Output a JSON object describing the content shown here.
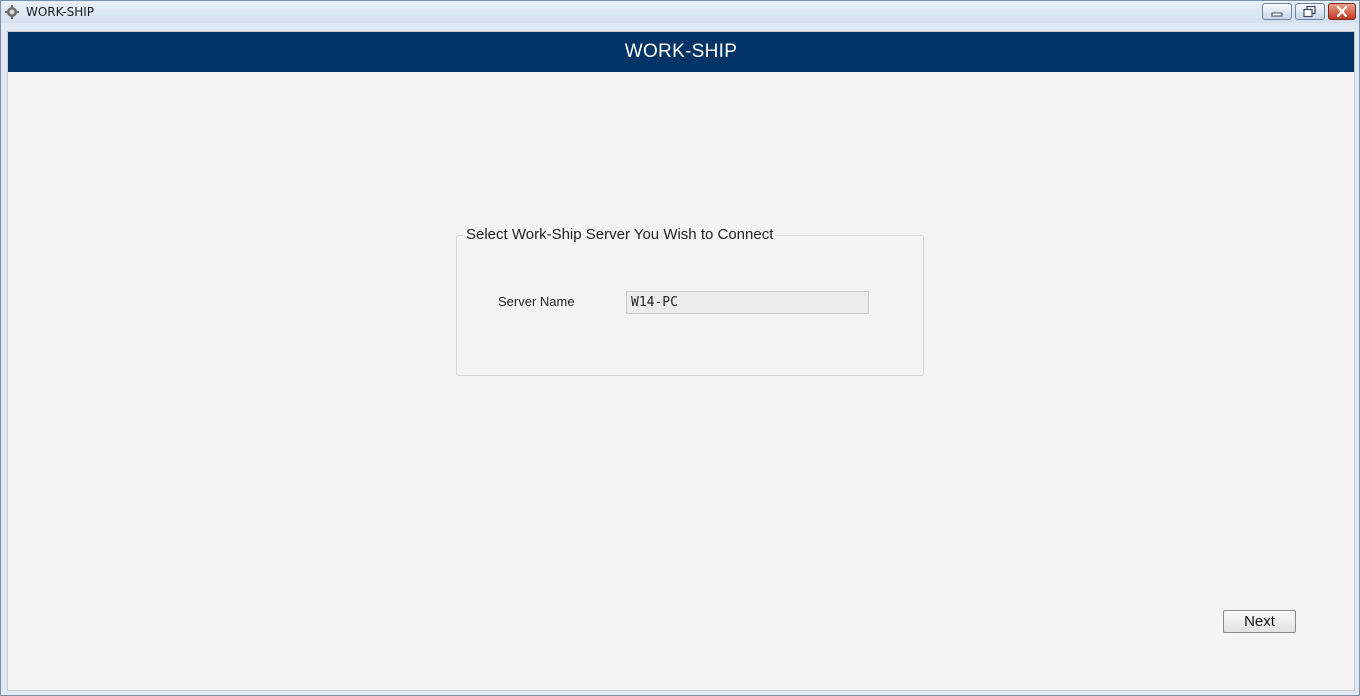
{
  "window": {
    "title": "WORK-SHIP",
    "controls": {
      "minimize_icon": "minimize-icon",
      "restore_icon": "restore-icon",
      "close_icon": "close-icon"
    }
  },
  "banner": {
    "title": "WORK-SHIP",
    "color": "#003366"
  },
  "server_group": {
    "legend": "Select Work-Ship Server You Wish to Connect",
    "server_name_label": "Server Name",
    "server_name_value": "W14-PC"
  },
  "actions": {
    "next_label": "Next"
  }
}
